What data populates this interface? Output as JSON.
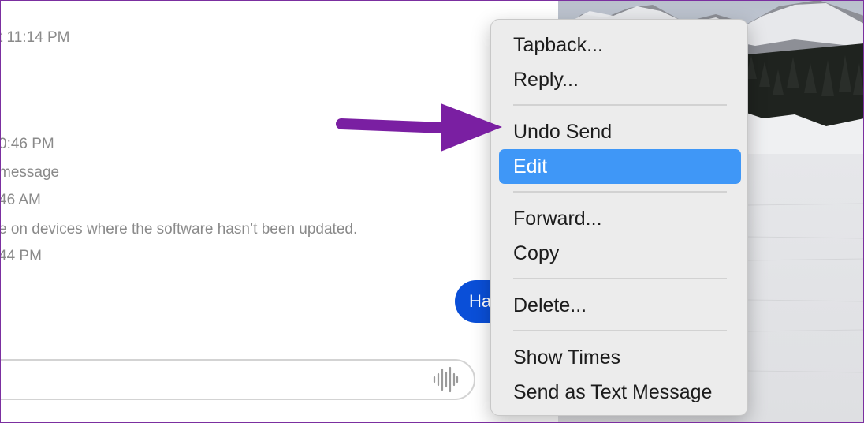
{
  "messages": {
    "lines": [
      "t 11:14 PM",
      "0:46 PM",
      " message",
      "46 AM",
      "e on devices where the software hasn’t been updated.",
      "44 PM"
    ],
    "bubble_text": "Ha",
    "input_icon": "audio-waveform-icon"
  },
  "context_menu": {
    "items": [
      {
        "label": "Tapback..."
      },
      {
        "label": "Reply..."
      },
      {
        "label": "Undo Send"
      },
      {
        "label": "Edit",
        "selected": true
      },
      {
        "label": "Forward..."
      },
      {
        "label": "Copy"
      },
      {
        "label": "Delete..."
      },
      {
        "label": "Show Times"
      },
      {
        "label": "Send as Text Message"
      }
    ]
  },
  "annotation": {
    "arrow_color": "#7a1fa2"
  },
  "colors": {
    "selection": "#3f97f7",
    "bubble": "#0a4fd8"
  }
}
